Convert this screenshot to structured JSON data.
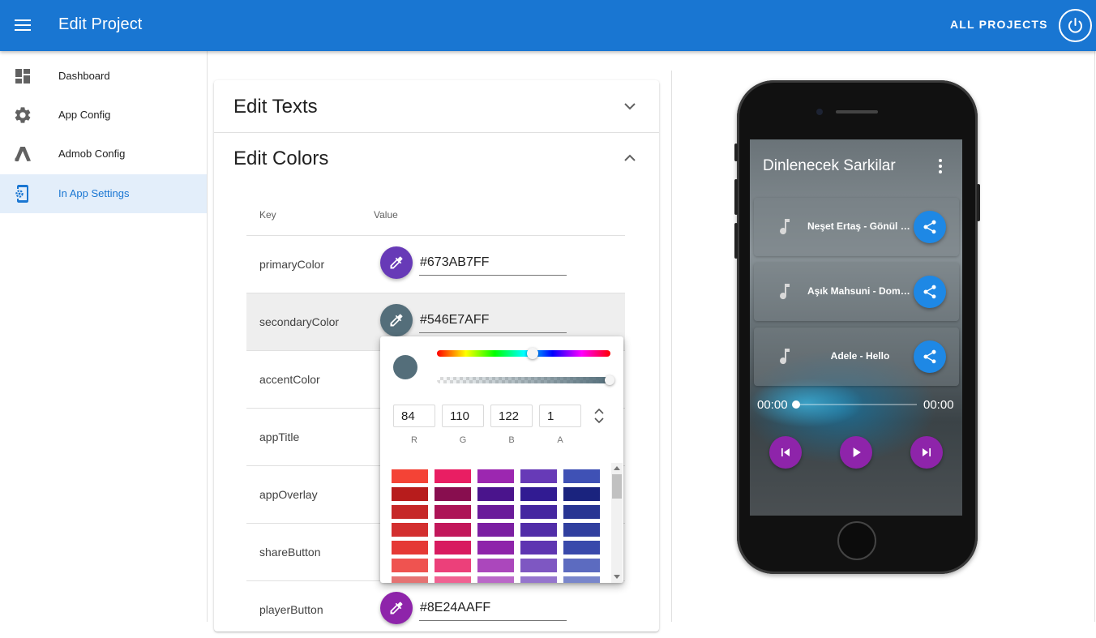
{
  "appbar": {
    "title": "Edit Project",
    "all_projects_label": "ALL PROJECTS"
  },
  "sidebar": {
    "items": [
      {
        "label": "Dashboard",
        "icon": "dashboard-icon"
      },
      {
        "label": "App Config",
        "icon": "gear-icon"
      },
      {
        "label": "Admob Config",
        "icon": "admob-icon"
      },
      {
        "label": "In App Settings",
        "icon": "phone-settings-icon",
        "active": true
      }
    ]
  },
  "panels": {
    "edit_texts": {
      "title": "Edit Texts",
      "expanded": false
    },
    "edit_colors": {
      "title": "Edit Colors",
      "expanded": true
    }
  },
  "colors_table": {
    "headers": {
      "key": "Key",
      "value": "Value"
    },
    "rows": [
      {
        "key": "primaryColor",
        "value": "#673AB7FF",
        "color": "#673ab7"
      },
      {
        "key": "secondaryColor",
        "value": "#546E7AFF",
        "color": "#546e7a",
        "highlighted": true
      },
      {
        "key": "accentColor"
      },
      {
        "key": "appTitle"
      },
      {
        "key": "appOverlay"
      },
      {
        "key": "shareButton"
      },
      {
        "key": "playerButton",
        "value": "#8E24AAFF",
        "color": "#8e24aa"
      }
    ]
  },
  "color_picker": {
    "preview_color": "#546e7a",
    "r": "84",
    "g": "110",
    "b": "122",
    "a": "1",
    "labels": {
      "r": "R",
      "g": "G",
      "b": "B",
      "a": "A"
    },
    "palette_rows": [
      [
        "#f44336",
        "#e91e63",
        "#9c27b0",
        "#673ab7",
        "#3f51b5"
      ],
      [
        "#b71c1c",
        "#880e4f",
        "#4a148c",
        "#311b92",
        "#1a237e"
      ],
      [
        "#c62828",
        "#ad1457",
        "#6a1b9a",
        "#4527a0",
        "#283593"
      ],
      [
        "#d32f2f",
        "#c2185b",
        "#7b1fa2",
        "#512da8",
        "#303f9f"
      ],
      [
        "#e53935",
        "#d81b60",
        "#8e24aa",
        "#5e35b1",
        "#3949ab"
      ],
      [
        "#ef5350",
        "#ec407a",
        "#ab47bc",
        "#7e57c2",
        "#5c6bc0"
      ],
      [
        "#e57373",
        "#f06292",
        "#ba68c8",
        "#9575cd",
        "#7986cb"
      ]
    ]
  },
  "phone_preview": {
    "app_title": "Dinlenecek Sarkilar",
    "songs": [
      {
        "title": "Neşet Ertaş - Gönül Dağı"
      },
      {
        "title": "Aşık Mahsuni - Dom Dom Kurşunu"
      },
      {
        "title": "Adele - Hello"
      }
    ],
    "time_elapsed": "00:00",
    "time_total": "00:00",
    "share_color": "#1e88e5",
    "player_color": "#8e24aa"
  }
}
